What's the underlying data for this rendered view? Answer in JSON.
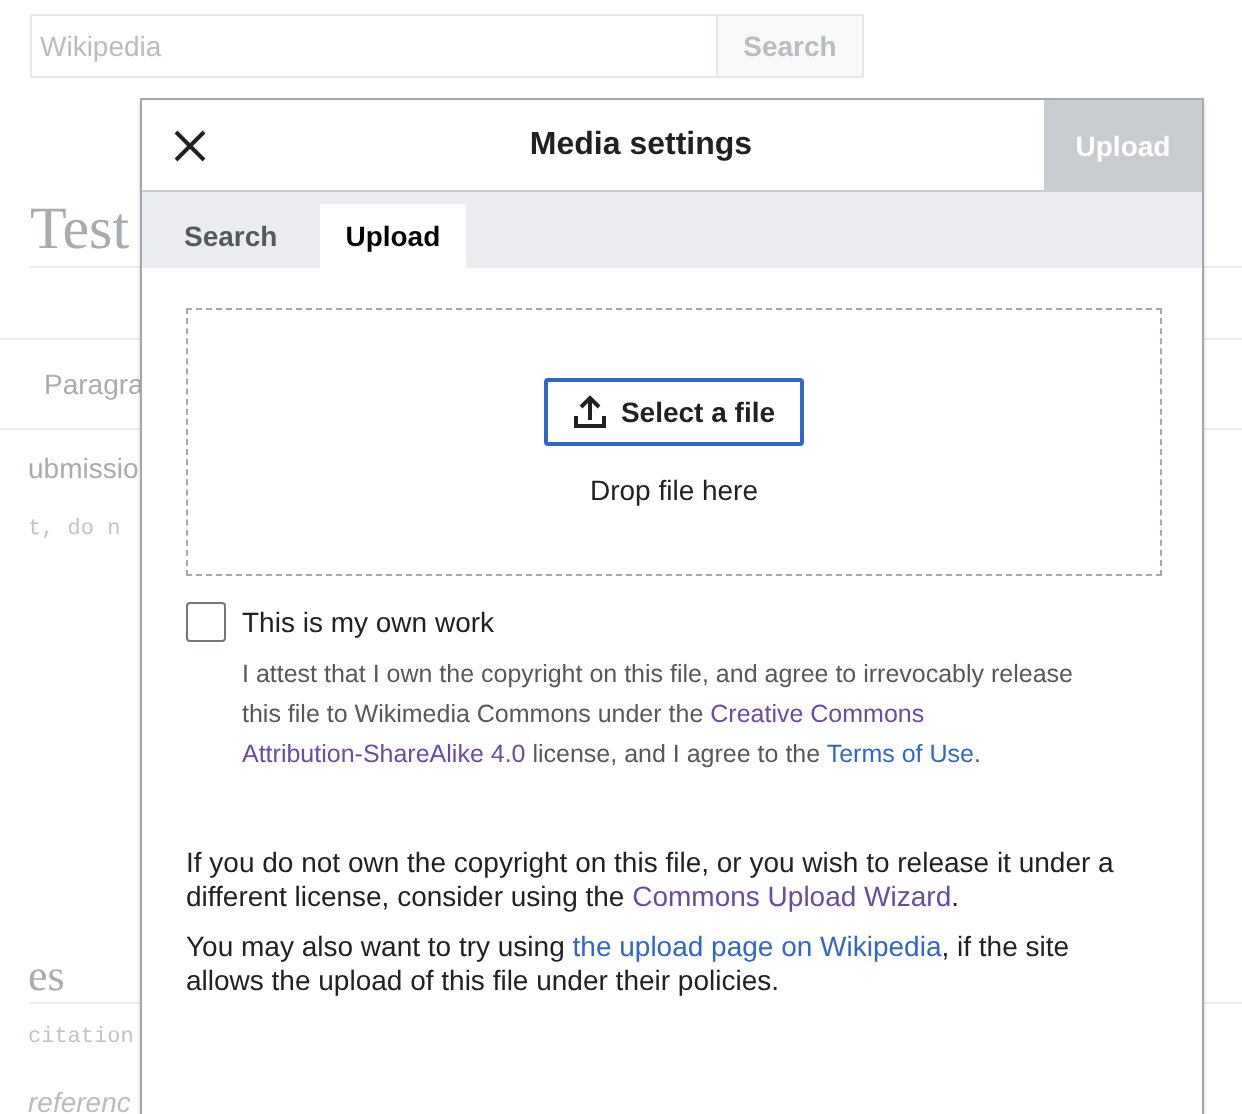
{
  "page": {
    "search": {
      "placeholder": "Wikipedia",
      "button": "Search"
    },
    "heading": "Test",
    "toolbar_text": "Paragra",
    "line_1": "ubmissio",
    "line_2": "t, do n",
    "section_heading": "es",
    "line_3": "citation",
    "line_4": "referenc"
  },
  "dialog": {
    "title": "Media settings",
    "action": {
      "label": "Upload",
      "disabled": true
    },
    "tabs": [
      {
        "label": "Search",
        "selected": false
      },
      {
        "label": "Upload",
        "selected": true
      }
    ],
    "dropzone": {
      "button": "Select a file",
      "hint": "Drop file here"
    },
    "own_work": {
      "label": "This is my own work",
      "checked": false,
      "description": [
        {
          "kind": "text",
          "text": "I attest that I own the copyright on this file, and agree to irrevocably release this file to Wikimedia Commons under the "
        },
        {
          "kind": "link",
          "text": "Creative Commons",
          "visited": true
        },
        {
          "kind": "link",
          "text": "Attribution-ShareAlike 4.0",
          "visited": true
        },
        {
          "kind": "text",
          "text": " license, and I agree to the "
        },
        {
          "kind": "link",
          "text": "Terms of Use",
          "visited": false
        },
        {
          "kind": "text",
          "text": "."
        }
      ]
    },
    "paragraphs": [
      [
        {
          "kind": "text",
          "text": "If you do not own the copyright on this file, or you wish to release it under a different license, consider using the "
        },
        {
          "kind": "link",
          "text": "Commons Upload Wizard",
          "visited": true
        },
        {
          "kind": "text",
          "text": "."
        }
      ],
      [
        {
          "kind": "text",
          "text": "You may also want to try using "
        },
        {
          "kind": "link",
          "text": "the upload page on Wikipedia",
          "visited": false
        },
        {
          "kind": "text",
          "text": ", if the site allows the upload of this file under their policies."
        }
      ]
    ]
  }
}
